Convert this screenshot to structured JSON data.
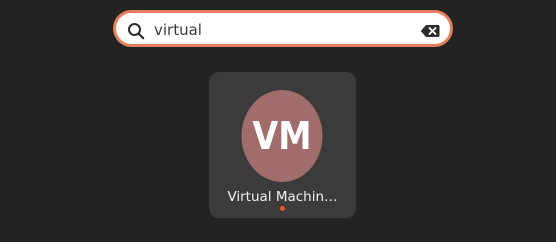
{
  "search": {
    "value": "virtual",
    "icon": "search-icon",
    "clear_icon": "clear-icon",
    "accent_color": "#e67d5b"
  },
  "results": [
    {
      "label": "Virtual Machin…",
      "icon_text": "VM",
      "icon_color": "#a06d6a",
      "running_indicator_color": "#e95420"
    }
  ]
}
